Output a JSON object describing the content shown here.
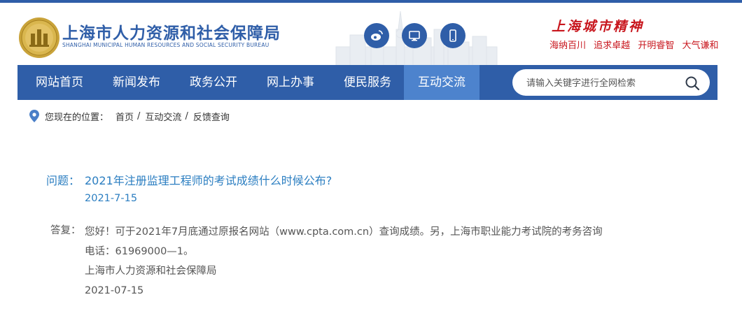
{
  "header": {
    "title": "上海市人力资源和社会保障局",
    "subtitle": "SHANGHAI MUNICIPAL HUMAN RESOURCES AND SOCIAL SECURITY BUREAU",
    "spirit_title": "上海城市精神",
    "spirit_phrases": [
      "海纳百川",
      "追求卓越",
      "开明睿智",
      "大气谦和"
    ],
    "icons": [
      "weibo-icon",
      "computer-icon",
      "mobile-icon"
    ]
  },
  "nav": {
    "items": [
      "网站首页",
      "新闻发布",
      "政务公开",
      "网上办事",
      "便民服务",
      "互动交流"
    ],
    "active": "互动交流"
  },
  "search": {
    "placeholder": "请输入关键字进行全网检索"
  },
  "breadcrumb": {
    "label": "您现在的位置：",
    "items": [
      "首页",
      "互动交流",
      "反馈查询"
    ]
  },
  "question": {
    "label": "问题：",
    "text": "2021年注册监理工程师的考试成绩什么时候公布?",
    "date": "2021-7-15"
  },
  "answer": {
    "label": "答复：",
    "lines": [
      "您好！可于2021年7月底通过原报名网站（www.cpta.com.cn）查询成绩。另，上海市职业能力考试院的考务咨询",
      "电话：61969000—1。",
      "上海市人力资源和社会保障局",
      "2021-07-15"
    ]
  },
  "colors": {
    "brand_blue": "#2f5ea8",
    "nav_active": "#4d83cd",
    "link_blue": "#2b7ec1",
    "spirit_red": "#c8161d",
    "body_text": "#555555"
  }
}
